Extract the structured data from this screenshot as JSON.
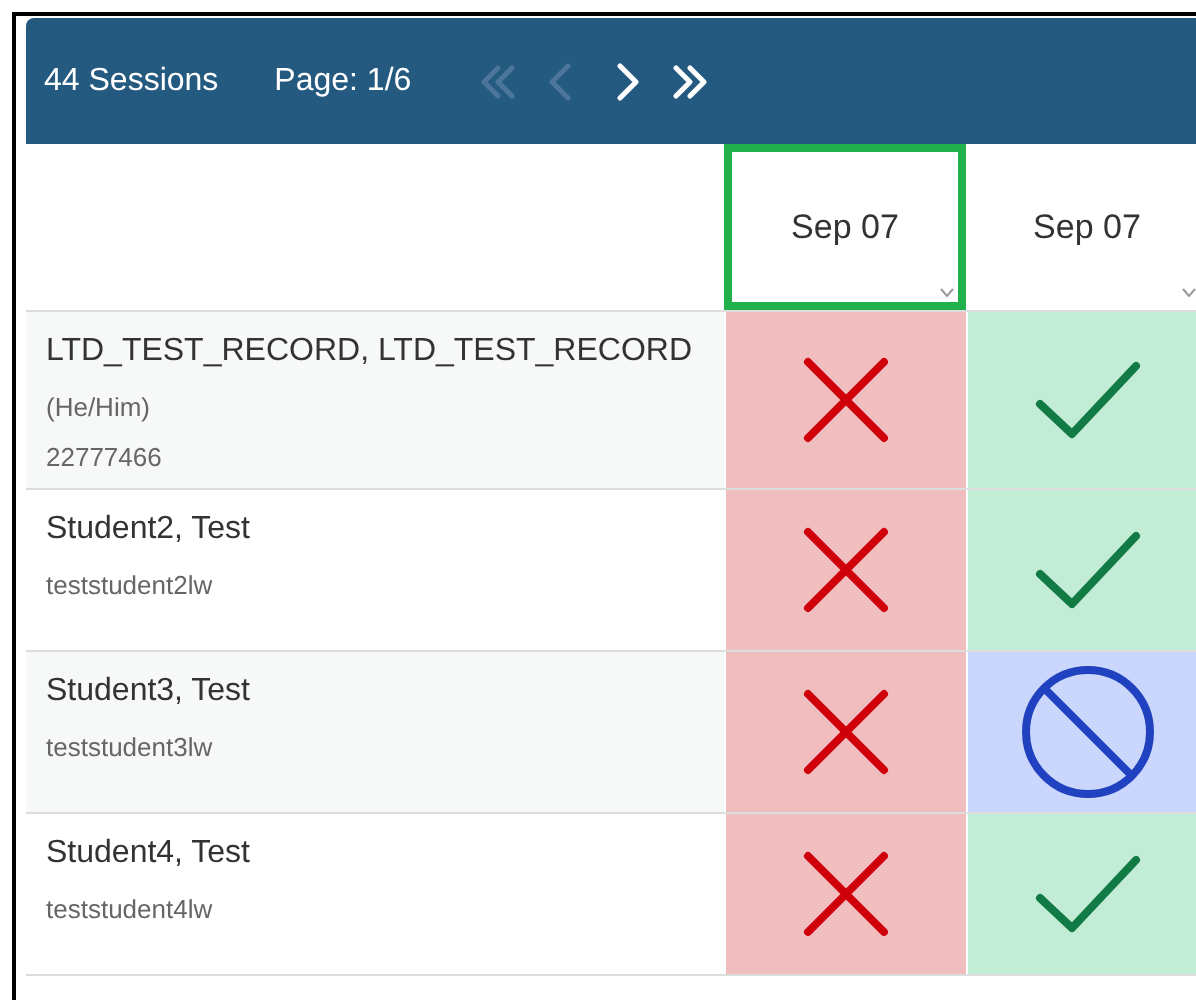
{
  "toolbar": {
    "sessions": "44 Sessions",
    "page": "Page: 1/6",
    "nav": [
      {
        "kind": "first",
        "disabled": true
      },
      {
        "kind": "prev",
        "disabled": true
      },
      {
        "kind": "next",
        "disabled": false
      },
      {
        "kind": "last",
        "disabled": false
      }
    ]
  },
  "columns": [
    {
      "label": "Sep 07",
      "selected": true
    },
    {
      "label": "Sep 07",
      "selected": false
    }
  ],
  "rows": [
    {
      "name": "LTD_TEST_RECORD, LTD_TEST_RECORD",
      "details": [
        "(He/Him)",
        "22777466"
      ],
      "cells": [
        {
          "kind": "absent"
        },
        {
          "kind": "present"
        }
      ]
    },
    {
      "name": "Student2, Test",
      "details": [
        "teststudent2lw"
      ],
      "cells": [
        {
          "kind": "absent"
        },
        {
          "kind": "present"
        }
      ]
    },
    {
      "name": "Student3, Test",
      "details": [
        "teststudent3lw"
      ],
      "cells": [
        {
          "kind": "absent"
        },
        {
          "kind": "excused"
        }
      ]
    },
    {
      "name": "Student4, Test",
      "details": [
        "teststudent4lw"
      ],
      "cells": [
        {
          "kind": "absent"
        },
        {
          "kind": "present"
        }
      ]
    }
  ]
}
